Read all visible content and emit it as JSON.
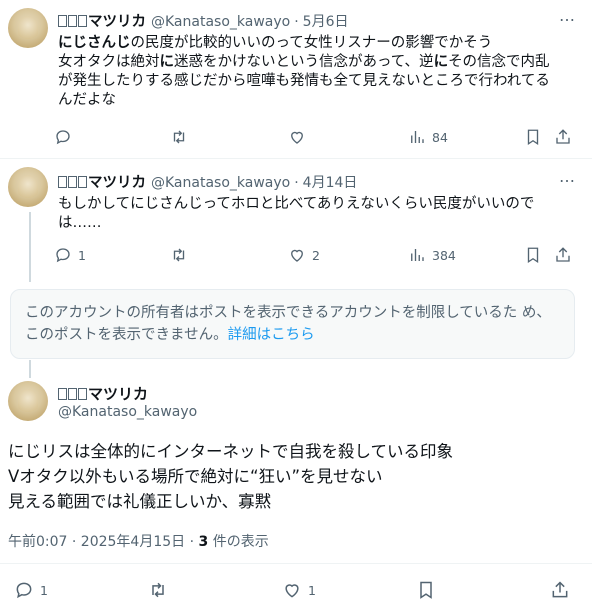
{
  "tweets": [
    {
      "name": "マツリカ",
      "handle": "@Kanataso_kawayo",
      "date": "5月6日",
      "more_label": "…",
      "text_bold1": "にじさんじ",
      "text_part1": "の民度が比較的いいのって女性リスナーの影響でかそう",
      "text_line2a": "女オタクは絶対",
      "text_bold2": "に",
      "text_line2b": "迷惑をかけないという信念があって、逆",
      "text_bold3": "に",
      "text_line2c": "その信念で内乱",
      "text_line3": "が発生したりする感じだから喧嘩も発情も全て見えないところで行われてる",
      "text_line4": "んだよな",
      "replies": "",
      "retweets": "",
      "likes": "",
      "views": "84"
    },
    {
      "name": "マツリカ",
      "handle": "@Kanataso_kawayo",
      "date": "4月14日",
      "more_label": "…",
      "text_line1": "もしかしてにじさんじってホロと比べてありえないくらい民度がいいので",
      "text_line2": "は……",
      "replies": "1",
      "retweets": "",
      "likes": "2",
      "views": "384"
    }
  ],
  "notice": {
    "text": "このアカウントの所有者はポストを表示できるアカウントを制限しているた め、このポストを表示できません。",
    "link": "詳細はこちら"
  },
  "main": {
    "name": "マツリカ",
    "handle": "@Kanataso_kawayo",
    "line1": "にじリスは全体的にインターネットで自我を殺している印象",
    "line2": "Vオタク以外もいる場所で絶対に“狂い”を見せない",
    "line3": "見える範囲では礼儀正しいか、寡黙",
    "time": "午前0:07 · 2025年4月15日 · ",
    "views_count": "3",
    "views_label": " 件の表示",
    "replies": "1",
    "retweets": "",
    "likes": "1"
  }
}
